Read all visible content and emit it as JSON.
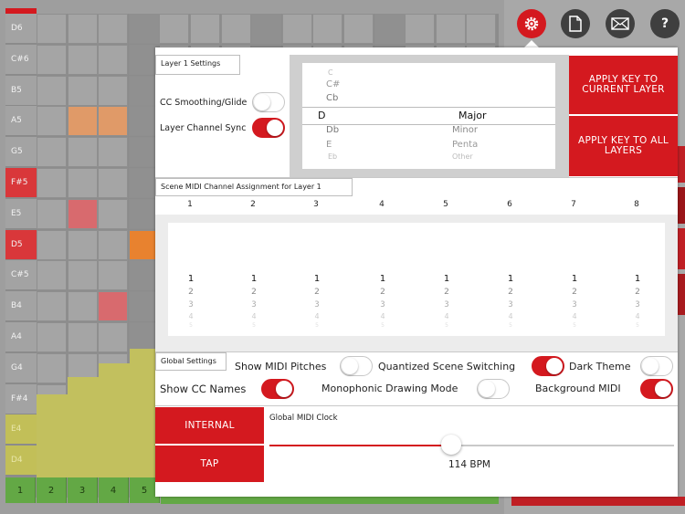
{
  "grid": {
    "notes": [
      "D6",
      "C#6",
      "B5",
      "A5",
      "G5",
      "F#5",
      "E5",
      "D5",
      "C#5",
      "B4",
      "A4",
      "G4",
      "F#4",
      "E4",
      "D4"
    ],
    "red_notes": [
      "F#5",
      "D5"
    ],
    "yellow_notes": [
      "E4",
      "D4"
    ],
    "columns": [
      "1",
      "2",
      "3",
      "4",
      "5"
    ]
  },
  "toolbar": {
    "settings_icon": "gear-icon",
    "document_icon": "document-icon",
    "mail_icon": "mail-icon",
    "help_icon": "help-icon",
    "help_glyph": "?"
  },
  "layer_settings": {
    "title": "Layer 1 Settings",
    "cc_smoothing_label": "CC Smoothing/Glide",
    "cc_smoothing_on": false,
    "channel_sync_label": "Layer Channel Sync",
    "channel_sync_on": true
  },
  "key_picker": {
    "roots": [
      "C",
      "C#",
      "Cb",
      "D",
      "Db",
      "E",
      "Eb"
    ],
    "selected_root": "D",
    "scales": [
      "Major",
      "Minor",
      "Penta",
      "Other"
    ],
    "selected_scale": "Major"
  },
  "apply_current_label": "APPLY KEY TO CURRENT LAYER",
  "apply_all_label": "APPLY KEY TO ALL LAYERS",
  "scene_assign": {
    "title": "Scene MIDI Channel Assignment for Layer 1",
    "scenes": [
      "1",
      "2",
      "3",
      "4",
      "5",
      "6",
      "7",
      "8"
    ],
    "wheel_values": [
      "1",
      "2",
      "3",
      "4",
      "5"
    ]
  },
  "global": {
    "title": "Global Settings",
    "show_midi_pitches_label": "Show MIDI Pitches",
    "show_midi_pitches_on": false,
    "quantized_label": "Quantized Scene Switching",
    "quantized_on": true,
    "dark_theme_label": "Dark Theme",
    "dark_theme_on": false,
    "show_cc_label": "Show CC Names",
    "show_cc_on": true,
    "mono_label": "Monophonic Drawing Mode",
    "mono_on": false,
    "background_midi_label": "Background MIDI",
    "background_midi_on": true
  },
  "clock": {
    "internal_label": "INTERNAL",
    "tap_label": "TAP",
    "title": "Global MIDI Clock",
    "bpm_text": "114 BPM",
    "slider_fraction": 0.45
  },
  "colors": {
    "accent": "#d4191f",
    "grid_bg": "#9e9e9e",
    "green": "#63a845",
    "yellow": "#c2c05e"
  }
}
